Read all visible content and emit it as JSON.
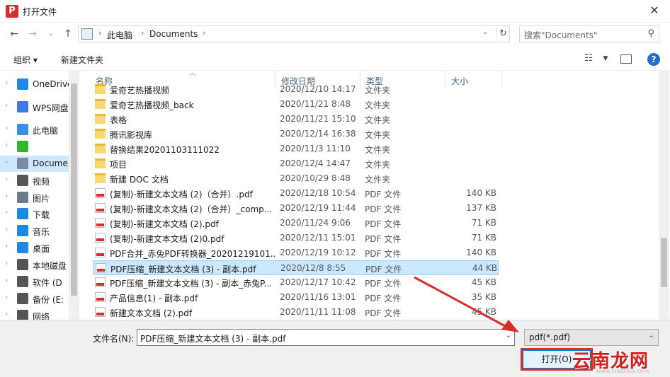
{
  "window": {
    "title": "打开文件",
    "app_icon_glyph": "P",
    "close_glyph": "✕"
  },
  "nav": {
    "breadcrumb": [
      "此电脑",
      "Documents"
    ],
    "search_placeholder": "搜索\"Documents\""
  },
  "toolbar": {
    "organize_label": "组织 ▾",
    "new_folder_label": "新建文件夹"
  },
  "sidebar": {
    "items": [
      {
        "label": "OneDrive",
        "icon": "cloud-icon",
        "color": "#1e88e5"
      },
      {
        "label": "WPS网盘",
        "icon": "cloud-icon",
        "color": "#3d7be0"
      },
      {
        "label": "此电脑",
        "icon": "computer-icon",
        "color": "#3a8ee6"
      },
      {
        "label": "",
        "icon": "wechat-icon",
        "color": "#2eb82e"
      },
      {
        "label": "Documents",
        "icon": "document-icon",
        "color": "#7a8ba0"
      },
      {
        "label": "视频",
        "icon": "video-icon",
        "color": "#555555"
      },
      {
        "label": "图片",
        "icon": "picture-icon",
        "color": "#6b7b8c"
      },
      {
        "label": "下载",
        "icon": "download-icon",
        "color": "#1e88e5"
      },
      {
        "label": "音乐",
        "icon": "music-icon",
        "color": "#1e88e5"
      },
      {
        "label": "桌面",
        "icon": "desktop-icon",
        "color": "#1e88e5"
      },
      {
        "label": "本地磁盘",
        "icon": "disk-icon",
        "color": "#555555"
      },
      {
        "label": "软件 (D",
        "icon": "disk-icon",
        "color": "#555555"
      },
      {
        "label": "备份 (E:",
        "icon": "disk-icon",
        "color": "#555555"
      },
      {
        "label": "网络",
        "icon": "network-icon",
        "color": "#555555"
      }
    ]
  },
  "columns": {
    "name": "名称",
    "date": "修改日期",
    "type": "类型",
    "size": "大小"
  },
  "files": [
    {
      "name": "爱奇艺热播视频",
      "date": "2020/12/10 14:17",
      "type": "文件夹",
      "size": "",
      "kind": "folder"
    },
    {
      "name": "爱奇艺热播视频_back",
      "date": "2020/11/21 8:48",
      "type": "文件夹",
      "size": "",
      "kind": "folder"
    },
    {
      "name": "表格",
      "date": "2020/11/21 15:10",
      "type": "文件夹",
      "size": "",
      "kind": "folder"
    },
    {
      "name": "腾讯影视库",
      "date": "2020/12/14 16:38",
      "type": "文件夹",
      "size": "",
      "kind": "folder"
    },
    {
      "name": "替换结果20201103111022",
      "date": "2020/11/3 11:10",
      "type": "文件夹",
      "size": "",
      "kind": "folder"
    },
    {
      "name": "项目",
      "date": "2020/12/4 14:47",
      "type": "文件夹",
      "size": "",
      "kind": "folder"
    },
    {
      "name": "新建 DOC 文档",
      "date": "2020/10/29 8:48",
      "type": "文件夹",
      "size": "",
      "kind": "folder"
    },
    {
      "name": "(复制)-新建文本文档 (2)（合并）.pdf",
      "date": "2020/12/18 10:54",
      "type": "PDF 文件",
      "size": "140 KB",
      "kind": "pdf"
    },
    {
      "name": "(复制)-新建文本文档 (2)（合并）_comp...",
      "date": "2020/12/19 11:44",
      "type": "PDF 文件",
      "size": "137 KB",
      "kind": "pdf"
    },
    {
      "name": "(复制)-新建文本文档 (2).pdf",
      "date": "2020/11/24 9:06",
      "type": "PDF 文件",
      "size": "71 KB",
      "kind": "pdf"
    },
    {
      "name": "(复制)-新建文本文档 (2)0.pdf",
      "date": "2020/12/11 15:01",
      "type": "PDF 文件",
      "size": "71 KB",
      "kind": "pdf"
    },
    {
      "name": "PDF合并_赤兔PDF转换器_20201219101...",
      "date": "2020/12/19 10:12",
      "type": "PDF 文件",
      "size": "140 KB",
      "kind": "pdf"
    },
    {
      "name": "PDF压缩_新建文本文档 (3) - 副本.pdf",
      "date": "2020/12/8 8:55",
      "type": "PDF 文件",
      "size": "44 KB",
      "kind": "pdf",
      "selected": true
    },
    {
      "name": "PDF压缩_新建文本文档 (3) - 副本_赤兔P...",
      "date": "2020/12/17 10:42",
      "type": "PDF 文件",
      "size": "45 KB",
      "kind": "pdf"
    },
    {
      "name": "产品信息(1) - 副本.pdf",
      "date": "2020/11/16 13:01",
      "type": "PDF 文件",
      "size": "35 KB",
      "kind": "pdf"
    },
    {
      "name": "新建文本文档 (2).pdf",
      "date": "2020/11/11 11:08",
      "type": "PDF 文件",
      "size": "45 KB",
      "kind": "pdf"
    }
  ],
  "bottom": {
    "filename_label": "文件名(N):",
    "filename_value": "PDF压缩_新建文本文档 (3) - 副本.pdf",
    "filter_value": "pdf(*.pdf)",
    "open_label": "打开(O)"
  },
  "watermark": {
    "text": "云南龙网",
    "url": "www.xiazaiba.com"
  },
  "colors": {
    "selection": "#cce8ff",
    "accent": "#0078d7",
    "annotation_red": "#d32f2f"
  }
}
